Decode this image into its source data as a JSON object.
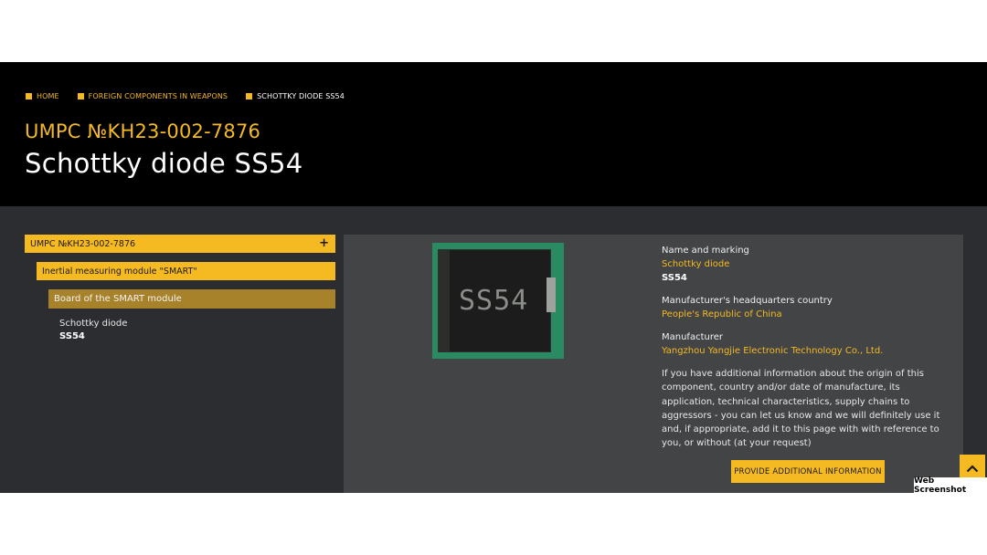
{
  "breadcrumb": {
    "items": [
      "HOME",
      "FOREIGN COMPONENTS IN WEAPONS",
      "SCHOTTKY DIODE SS54"
    ]
  },
  "header": {
    "subtitle": "UMPC №KH23-002-7876",
    "title": "Schottky diode SS54"
  },
  "tree": {
    "level1": "UMPC №KH23-002-7876",
    "level1_toggle": "+",
    "level2": "Inertial measuring module \"SMART\"",
    "level3": "Board of the SMART module",
    "leaf_name": "Schottky diode",
    "leaf_mark": "SS54"
  },
  "photo": {
    "marking": "SS54"
  },
  "details": {
    "name_label": "Name and marking",
    "name_value": "Schottky diode",
    "name_marking": "SS54",
    "hq_label": "Manufacturer's headquarters country",
    "hq_value": "People's Republic of China",
    "manufacturer_label": "Manufacturer",
    "manufacturer_value": "Yangzhou Yangjie Electronic Technology Co., Ltd.",
    "description": "If you have additional information about the origin of this component, country and/or date of manufacture, its application, technical characteristics, supply chains to aggressors - you can let us know and we will definitely use it and, if appropriate, add it to this page with with reference to you, or without (at your request)",
    "cta_label": "PROVIDE ADDITIONAL INFORMATION"
  },
  "badge": "Web Screenshot",
  "icons": {
    "breadcrumb_marker": "square-bullet-icon",
    "scroll_top": "chevron-up-icon"
  },
  "colors": {
    "accent": "#f5b922",
    "accent_dark": "#a7822a",
    "hero_bg": "#000000",
    "page_bg": "#2b2d30",
    "panel_bg": "#424446"
  }
}
